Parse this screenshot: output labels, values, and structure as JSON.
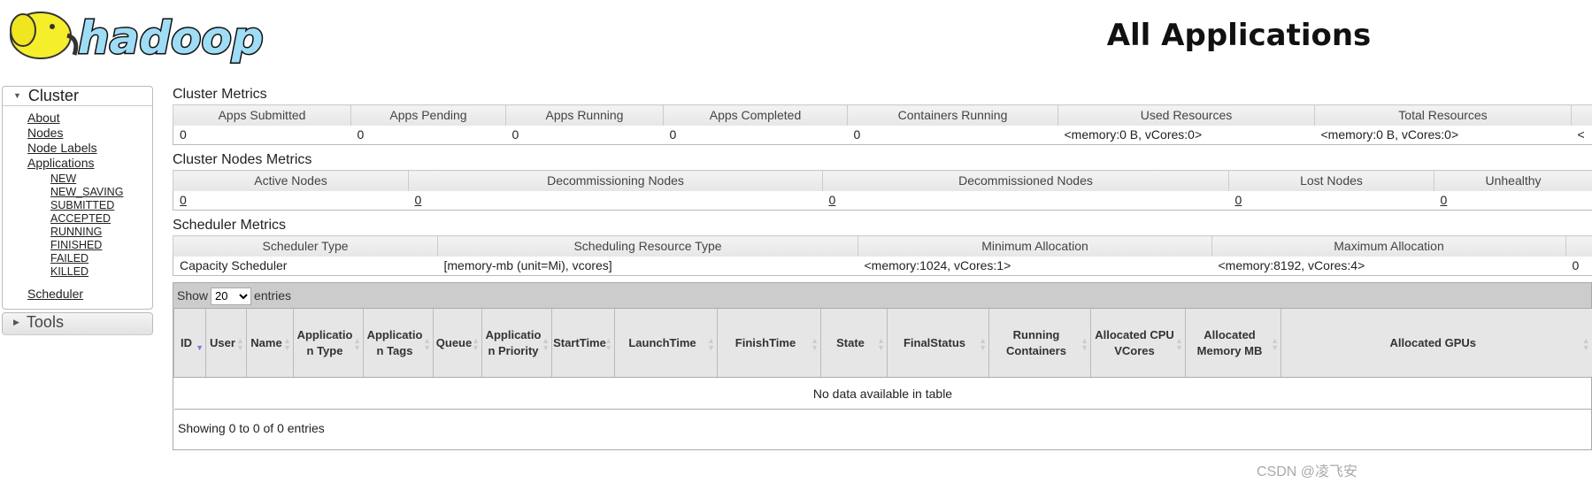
{
  "header": {
    "logo_text": "hadoop",
    "title": "All Applications"
  },
  "sidebar": {
    "cluster": {
      "label": "Cluster",
      "links": [
        "About",
        "Nodes",
        "Node Labels",
        "Applications"
      ],
      "app_states": [
        "NEW",
        "NEW_SAVING",
        "SUBMITTED",
        "ACCEPTED",
        "RUNNING",
        "FINISHED",
        "FAILED",
        "KILLED"
      ],
      "scheduler": "Scheduler"
    },
    "tools": {
      "label": "Tools"
    }
  },
  "cluster_metrics": {
    "title": "Cluster Metrics",
    "headers": [
      "Apps Submitted",
      "Apps Pending",
      "Apps Running",
      "Apps Completed",
      "Containers Running",
      "Used Resources",
      "Total Resources",
      ""
    ],
    "values": [
      "0",
      "0",
      "0",
      "0",
      "0",
      "<memory:0 B, vCores:0>",
      "<memory:0 B, vCores:0>",
      "<"
    ]
  },
  "nodes_metrics": {
    "title": "Cluster Nodes Metrics",
    "headers": [
      "Active Nodes",
      "Decommissioning Nodes",
      "Decommissioned Nodes",
      "Lost Nodes",
      "Unhealthy"
    ],
    "values": [
      "0",
      "0",
      "0",
      "0",
      "0"
    ]
  },
  "scheduler_metrics": {
    "title": "Scheduler Metrics",
    "headers": [
      "Scheduler Type",
      "Scheduling Resource Type",
      "Minimum Allocation",
      "Maximum Allocation",
      ""
    ],
    "values": [
      "Capacity Scheduler",
      "[memory-mb (unit=Mi), vcores]",
      "<memory:1024, vCores:1>",
      "<memory:8192, vCores:4>",
      "0"
    ]
  },
  "apps_table": {
    "show_label": "Show",
    "page_size": "20",
    "entries_label": "entries",
    "columns": [
      "ID",
      "User",
      "Name",
      "Application Type",
      "Application Tags",
      "Queue",
      "Application Priority",
      "StartTime",
      "LaunchTime",
      "FinishTime",
      "State",
      "FinalStatus",
      "Running Containers",
      "Allocated CPU VCores",
      "Allocated Memory MB",
      "Allocated GPUs"
    ],
    "sorted_column": "ID",
    "empty_message": "No data available in table",
    "footer": "Showing 0 to 0 of 0 entries"
  },
  "watermark": "CSDN @凌飞安"
}
